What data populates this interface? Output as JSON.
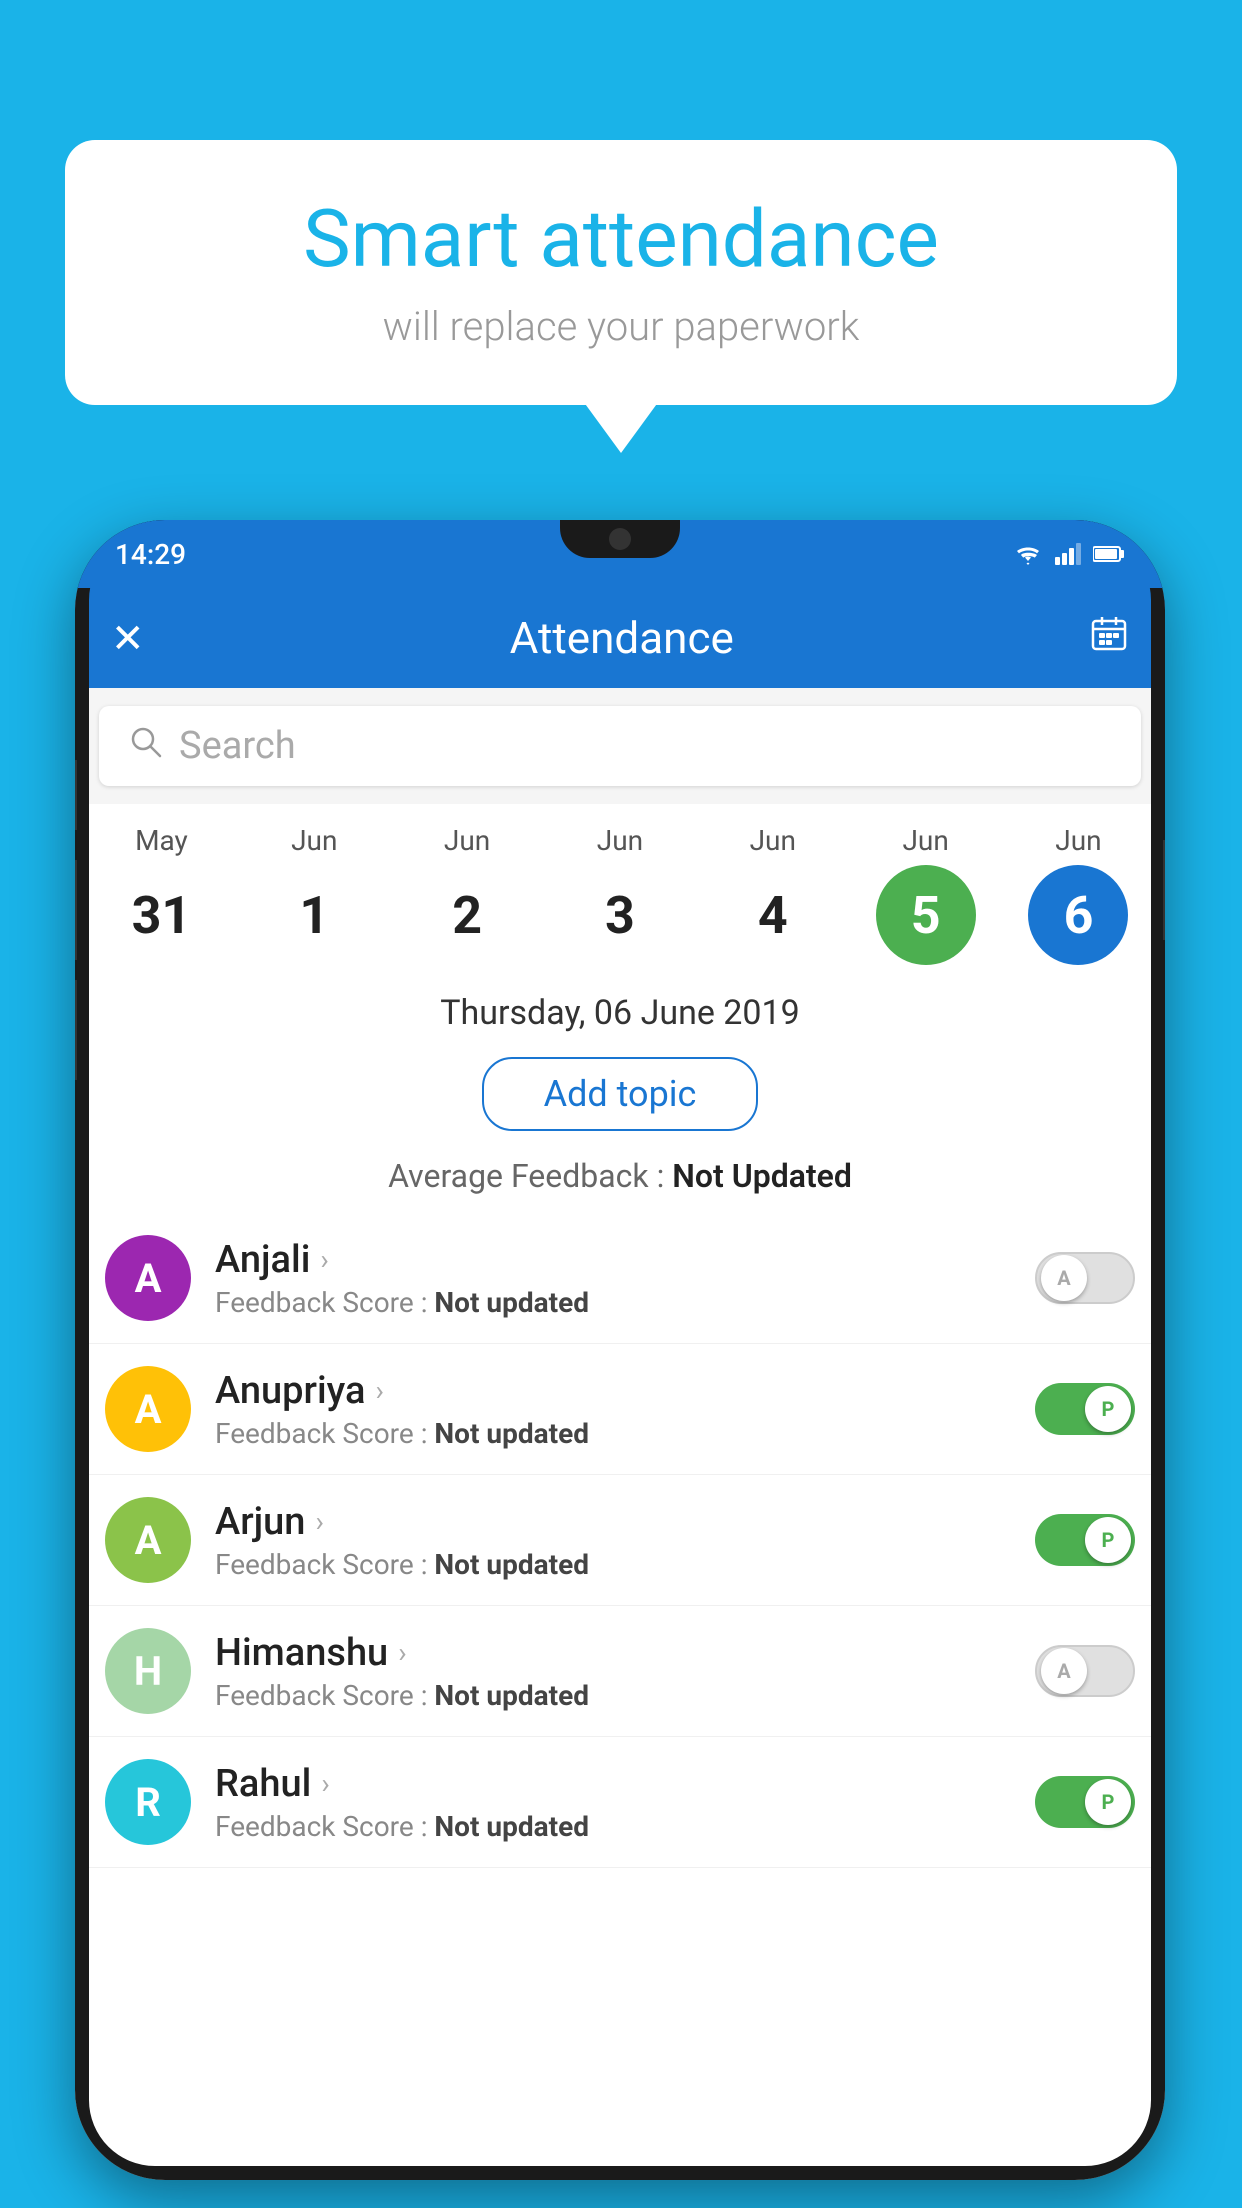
{
  "background_color": "#1ab3e8",
  "speech_bubble": {
    "title": "Smart attendance",
    "subtitle": "will replace your paperwork"
  },
  "phone": {
    "status_bar": {
      "time": "14:29",
      "icons": [
        "wifi",
        "signal",
        "battery"
      ]
    },
    "app_bar": {
      "close_icon": "✕",
      "title": "Attendance",
      "calendar_icon": "📅"
    },
    "search": {
      "placeholder": "Search"
    },
    "calendar": {
      "days": [
        {
          "month": "May",
          "date": "31",
          "state": "normal"
        },
        {
          "month": "Jun",
          "date": "1",
          "state": "normal"
        },
        {
          "month": "Jun",
          "date": "2",
          "state": "normal"
        },
        {
          "month": "Jun",
          "date": "3",
          "state": "normal"
        },
        {
          "month": "Jun",
          "date": "4",
          "state": "normal"
        },
        {
          "month": "Jun",
          "date": "5",
          "state": "today"
        },
        {
          "month": "Jun",
          "date": "6",
          "state": "selected"
        }
      ]
    },
    "selected_date": "Thursday, 06 June 2019",
    "add_topic_label": "Add topic",
    "avg_feedback_label": "Average Feedback : ",
    "avg_feedback_value": "Not Updated",
    "students": [
      {
        "name": "Anjali",
        "initial": "A",
        "avatar_color": "#9c27b0",
        "feedback_label": "Feedback Score : ",
        "feedback_value": "Not updated",
        "toggle_state": "off",
        "toggle_label": "A"
      },
      {
        "name": "Anupriya",
        "initial": "A",
        "avatar_color": "#ffc107",
        "feedback_label": "Feedback Score : ",
        "feedback_value": "Not updated",
        "toggle_state": "on",
        "toggle_label": "P"
      },
      {
        "name": "Arjun",
        "initial": "A",
        "avatar_color": "#8bc34a",
        "feedback_label": "Feedback Score : ",
        "feedback_value": "Not updated",
        "toggle_state": "on",
        "toggle_label": "P"
      },
      {
        "name": "Himanshu",
        "initial": "H",
        "avatar_color": "#a5d6a7",
        "feedback_label": "Feedback Score : ",
        "feedback_value": "Not updated",
        "toggle_state": "off",
        "toggle_label": "A"
      },
      {
        "name": "Rahul",
        "initial": "R",
        "avatar_color": "#26c6da",
        "feedback_label": "Feedback Score : ",
        "feedback_value": "Not updated",
        "toggle_state": "on",
        "toggle_label": "P"
      }
    ]
  }
}
